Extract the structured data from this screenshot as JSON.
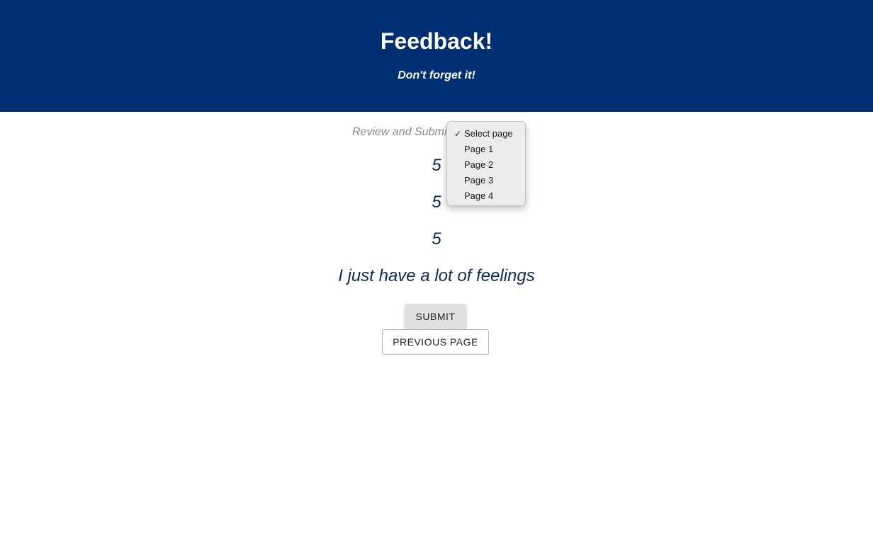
{
  "header": {
    "title": "Feedback!",
    "subtitle": "Don't forget it!"
  },
  "review": {
    "label": "Review and Submit",
    "ratings": [
      "5",
      "5",
      "5"
    ],
    "comment": "I just have a lot of feelings"
  },
  "page_select": {
    "selected": "Select page",
    "check_glyph": "✓",
    "options": [
      "Select page",
      "Page 1",
      "Page 2",
      "Page 3",
      "Page 4"
    ]
  },
  "buttons": {
    "submit_label": "SUBMIT",
    "previous_label": "PREVIOUS PAGE"
  },
  "colors": {
    "header_bg": "#003073",
    "text_dark": "#0f2a55"
  }
}
